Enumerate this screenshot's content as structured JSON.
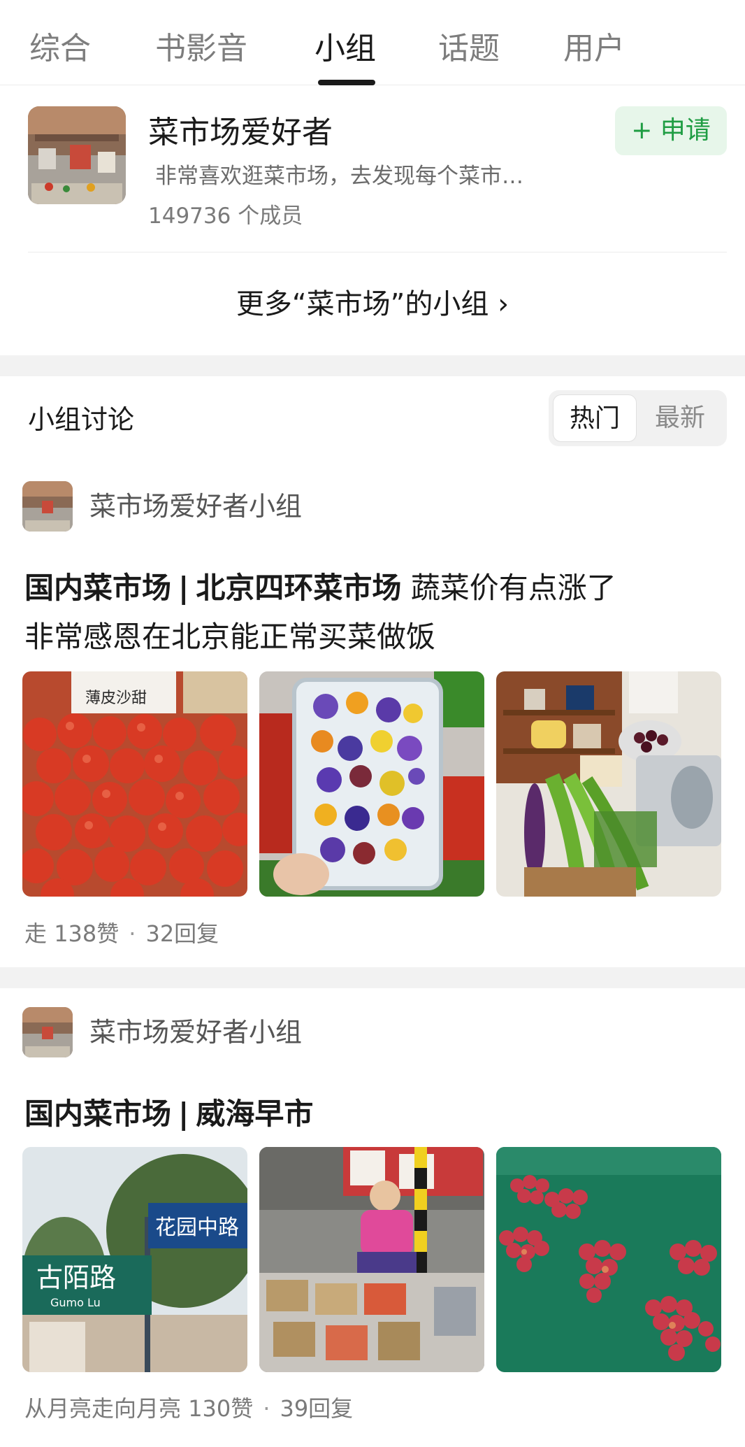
{
  "tabs": [
    {
      "label": "综合"
    },
    {
      "label": "书影音"
    },
    {
      "label": "小组",
      "active": true
    },
    {
      "label": "话题"
    },
    {
      "label": "用户"
    }
  ],
  "group_result": {
    "name": "菜市场爱好者",
    "description": "非常喜欢逛菜市场，去发现每个菜市…",
    "members": "149736 个成员",
    "apply_label": "+ 申请"
  },
  "more_groups_link": "更多“菜市场”的小组 ›",
  "discussion": {
    "title": "小组讨论",
    "sort_options": [
      "热门",
      "最新"
    ],
    "selected_sort": "热门"
  },
  "posts": [
    {
      "group_name": "菜市场爱好者小组",
      "title_bold_a": "国内菜市场",
      "title_sep": "|",
      "title_bold_b": "北京四环菜市场",
      "title_rest": " 蔬菜价有点涨了",
      "title_line2": "非常感恩在北京能正常买菜做饭",
      "author": "走",
      "likes": "138赞",
      "replies": "32回复",
      "image_sign_text": "薄皮沙甜"
    },
    {
      "group_name": "菜市场爱好者小组",
      "title_bold_a": "国内菜市场",
      "title_sep": "|",
      "title_bold_b": "威海早市",
      "author": "从月亮走向月亮",
      "likes": "130赞",
      "replies": "39回复",
      "street_sign_a": "古陌路",
      "street_sign_a_sub": "Gumo Lu",
      "street_sign_b": "花园中路"
    }
  ],
  "colors": {
    "accent_green": "#1f9d43",
    "apply_bg": "#e7f6ea",
    "section_gap": "#f2f2f2"
  }
}
